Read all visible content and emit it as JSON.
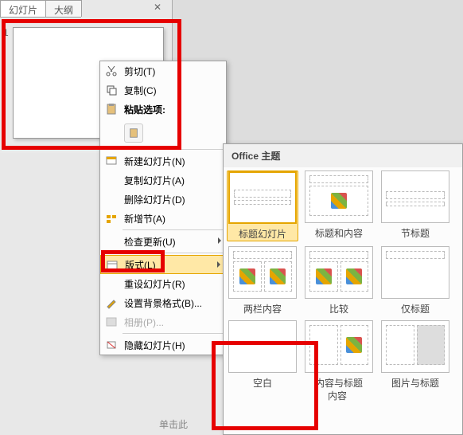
{
  "tabs": {
    "slides": "幻灯片",
    "outline": "大纲"
  },
  "slide_number": "1",
  "ctx": {
    "cut": "剪切(T)",
    "copy": "复制(C)",
    "paste_options": "粘贴选项:",
    "new_slide": "新建幻灯片(N)",
    "duplicate": "复制幻灯片(A)",
    "delete": "删除幻灯片(D)",
    "new_section": "新增节(A)",
    "check_update": "检查更新(U)",
    "layout": "版式(L)",
    "reset": "重设幻灯片(R)",
    "bg_format": "设置背景格式(B)...",
    "album": "相册(P)...",
    "hide": "隐藏幻灯片(H)"
  },
  "layout_panel": {
    "header": "Office 主题",
    "items": [
      "标题幻灯片",
      "标题和内容",
      "节标题",
      "两栏内容",
      "比较",
      "仅标题",
      "空白",
      "内容与标题",
      "图片与标题"
    ]
  },
  "bottom_hint": "单击此",
  "partial_label": "内容"
}
